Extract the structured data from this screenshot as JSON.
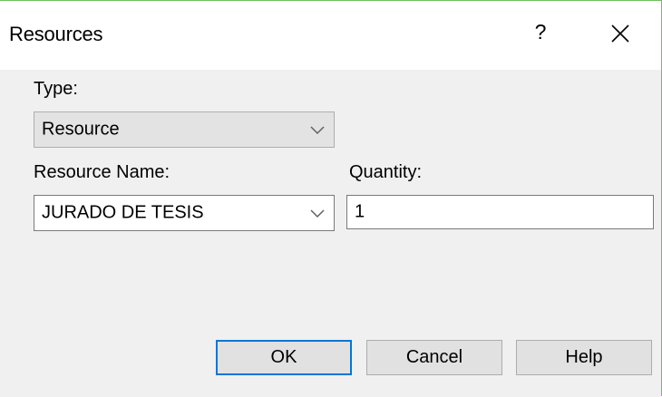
{
  "window": {
    "title": "Resources",
    "help_glyph": "?",
    "close_icon": "close-icon"
  },
  "form": {
    "type_label": "Type:",
    "type_value": "Resource",
    "resource_name_label": "Resource Name:",
    "resource_name_value": "JURADO DE TESIS",
    "quantity_label": "Quantity:",
    "quantity_value": "1"
  },
  "buttons": {
    "ok": "OK",
    "cancel": "Cancel",
    "help": "Help"
  },
  "colors": {
    "accent": "#0078d7",
    "client_bg": "#f0f0f0",
    "window_border": "#6fbf5b"
  }
}
